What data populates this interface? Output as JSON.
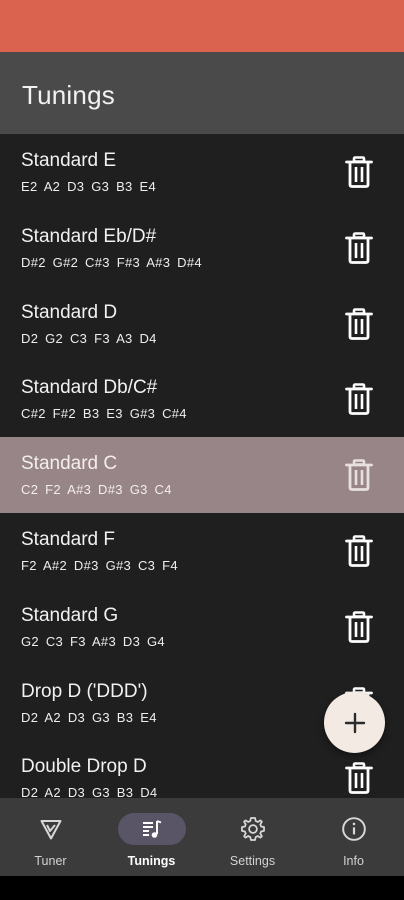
{
  "app_bar": {
    "title": "Tunings"
  },
  "tunings": [
    {
      "name": "Standard E",
      "notes": "E2 A2 D3 G3 B3 E4",
      "selected": false
    },
    {
      "name": "Standard Eb/D#",
      "notes": "D#2 G#2 C#3 F#3 A#3 D#4",
      "selected": false
    },
    {
      "name": "Standard D",
      "notes": "D2 G2 C3 F3 A3 D4",
      "selected": false
    },
    {
      "name": "Standard Db/C#",
      "notes": "C#2 F#2 B3 E3 G#3 C#4",
      "selected": false
    },
    {
      "name": "Standard C",
      "notes": "C2 F2 A#3 D#3 G3 C4",
      "selected": true
    },
    {
      "name": "Standard F",
      "notes": "F2 A#2 D#3 G#3 C3 F4",
      "selected": false
    },
    {
      "name": "Standard G",
      "notes": "G2 C3 F3 A#3 D3 G4",
      "selected": false
    },
    {
      "name": "Drop D ('DDD')",
      "notes": "D2 A2 D3 G3 B3 E4",
      "selected": false
    },
    {
      "name": "Double Drop D",
      "notes": "D2 A2 D3 G3 B3 D4",
      "selected": false
    }
  ],
  "fab": {
    "icon": "plus-icon"
  },
  "bottom_nav": [
    {
      "label": "Tuner",
      "icon": "tuner-icon",
      "active": false
    },
    {
      "label": "Tunings",
      "icon": "tunings-icon",
      "active": true
    },
    {
      "label": "Settings",
      "icon": "settings-icon",
      "active": false
    },
    {
      "label": "Info",
      "icon": "info-icon",
      "active": false
    }
  ],
  "colors": {
    "status_bar": "#d9634e",
    "app_bar": "#4a4a4a",
    "background": "#1f1f1f",
    "selected_row": "#978587",
    "fab": "#f3ebe3",
    "bottom_nav": "#3b3b3b",
    "nav_indicator": "#5a5566"
  }
}
